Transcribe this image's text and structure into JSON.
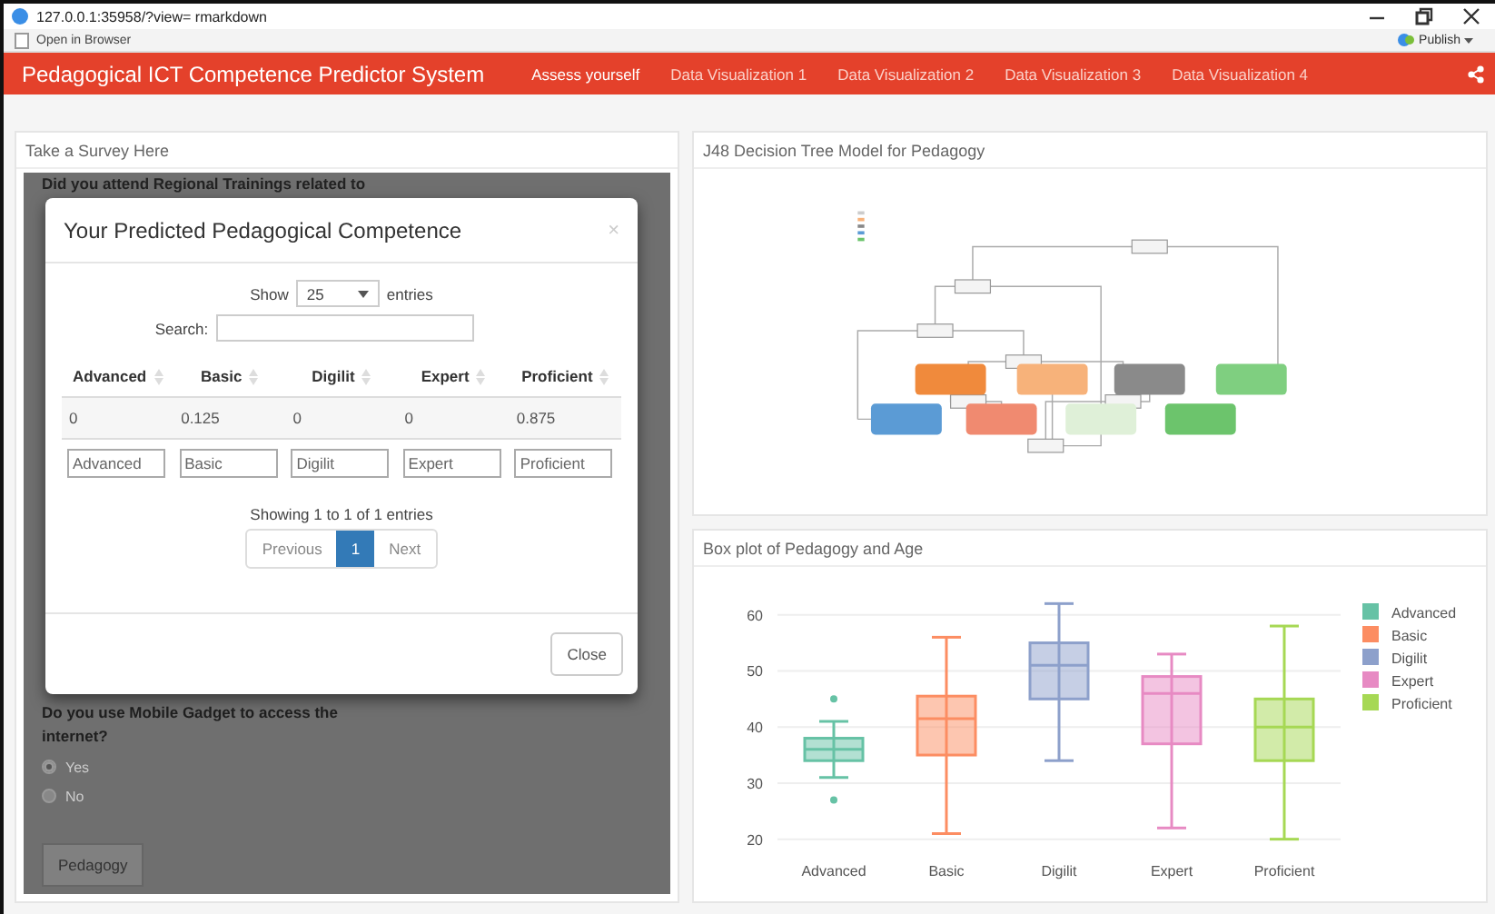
{
  "browser": {
    "url": "127.0.0.1:35958/?view= rmarkdown",
    "open_in_browser": "Open in Browser",
    "publish": "Publish"
  },
  "navbar": {
    "brand": "Pedagogical ICT Competence Predictor System",
    "items": [
      {
        "label": "Assess yourself",
        "selected": true
      },
      {
        "label": "Data Visualization 1",
        "selected": false
      },
      {
        "label": "Data Visualization 2",
        "selected": false
      },
      {
        "label": "Data Visualization 3",
        "selected": false
      },
      {
        "label": "Data Visualization 4",
        "selected": false
      }
    ]
  },
  "survey_panel": {
    "title": "Take a Survey Here",
    "cut_question": "Did you attend Regional Trainings related to",
    "question": "Do you use Mobile Gadget to access the internet?",
    "options": [
      {
        "label": "Yes",
        "selected": true
      },
      {
        "label": "No",
        "selected": false
      }
    ],
    "button": "Pedagogy"
  },
  "modal": {
    "title": "Your Predicted Pedagogical Competence",
    "close_icon": "×",
    "show_label": "Show",
    "length_value": "25",
    "entries_label": "entries",
    "search_label": "Search:",
    "columns": [
      "Advanced",
      "Basic",
      "Digilit",
      "Expert",
      "Proficient"
    ],
    "rows": [
      [
        "0",
        "0.125",
        "0",
        "0",
        "0.875"
      ]
    ],
    "filter_placeholders": [
      "Advanced",
      "Basic",
      "Digilit",
      "Expert",
      "Proficient"
    ],
    "info": "Showing 1 to 1 of 1 entries",
    "pages": [
      {
        "label": "Previous",
        "selected": false,
        "disabled": true
      },
      {
        "label": "1",
        "selected": true,
        "disabled": false
      },
      {
        "label": "Next",
        "selected": false,
        "disabled": true
      }
    ],
    "close_button": "Close"
  },
  "tree_panel": {
    "title": "J48 Decision Tree Model for Pedagogy"
  },
  "boxplot_panel": {
    "title": "Box plot of Pedagogy and Age",
    "y_ticks": [
      "60",
      "50",
      "40",
      "30",
      "20"
    ],
    "categories": [
      "Advanced",
      "Basic",
      "Digilit",
      "Expert",
      "Proficient"
    ],
    "legend": [
      {
        "label": "Advanced",
        "color": "#66c2a5"
      },
      {
        "label": "Basic",
        "color": "#fc8d62"
      },
      {
        "label": "Digilit",
        "color": "#8da0cb"
      },
      {
        "label": "Expert",
        "color": "#e78ac3"
      },
      {
        "label": "Proficient",
        "color": "#a6d854"
      }
    ]
  }
}
